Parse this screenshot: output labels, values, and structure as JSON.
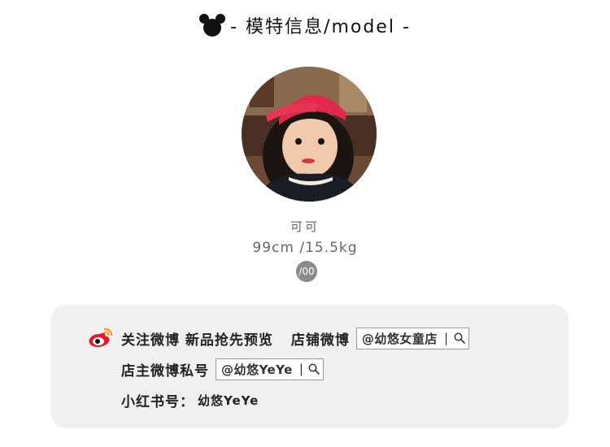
{
  "header": {
    "icon": "mickey-ears-icon",
    "title": "- 模特信息/model -"
  },
  "avatar": {
    "icon": "model-photo"
  },
  "model": {
    "name": "可可",
    "stats": "99cm /15.5kg",
    "badge": "/00"
  },
  "panel": {
    "weibo_icon": "weibo-icon",
    "row1_label": "关注微博 新品抢先预览",
    "store_label": "店铺微博",
    "store_handle": "@幼悠女童店",
    "row2_label": "店主微博私号",
    "owner_handle": "@幼悠YeYe",
    "row3_label": "小红书号：",
    "red_handle": "幼悠YeYe",
    "separator": "|",
    "search_icon": "search-icon"
  },
  "colors": {
    "panel_bg": "#f0f0f0",
    "badge_bg": "#8a8a8a",
    "weibo_red": "#e6162d",
    "weibo_orange": "#f39a1e"
  }
}
